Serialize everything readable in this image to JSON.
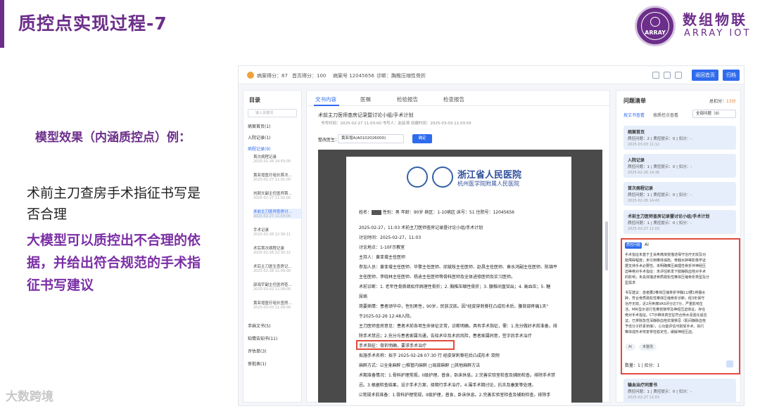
{
  "slide": {
    "title": "质控点实现过程-7",
    "brand_cn": "数组物联",
    "brand_en": "ARRAY IOT",
    "logo_text": "ARRAY",
    "model_label": "模型效果（内涵质控点）例：",
    "question": "术前主刀查房手术指征书写是否合理",
    "answer": "大模型可以质控出不合理的依据，并给出符合规范的手术指征书写建议",
    "watermark": "大数跨境"
  },
  "app": {
    "topbar": {
      "score": "病案得分：87",
      "home_score": "首页得分：100",
      "record_no": "病案号 12045656",
      "diagnosis": "诊断：胸椎压缩性骨折",
      "return_btn": "返回首页",
      "archive_btn": "归档"
    },
    "nav": {
      "title": "目录",
      "search_placeholder": "输入关键词",
      "items": [
        {
          "label": "病案首页(1)"
        },
        {
          "label": "入院记录(1)"
        },
        {
          "label": "病程记录(9)"
        }
      ],
      "subs": [
        {
          "label": "首次病程记录",
          "date": "2025-02-26 14:43:00"
        },
        {
          "label": "黄亚增医疗组长首次…",
          "date": "2025-02-27 11:01:00"
        },
        {
          "label": "刘颜文副主任医师首…",
          "date": "2025-02-27 11:02:00"
        },
        {
          "label": "术前主刀医师查房讨…",
          "date": "2025-02-27 11:03:00"
        },
        {
          "label": "手术记录",
          "date": "2025-02-28 22:30:11"
        },
        {
          "label": "术后首次病程记录",
          "date": "2025-02-28 22:30:22"
        },
        {
          "label": "术后主刀医生查房记…",
          "date": "2025-02-28 11:09:00"
        },
        {
          "label": "邵海宇副主任医师查…",
          "date": "2025-03-02 11:09:00"
        },
        {
          "label": "黄亚增医疗组长查房…",
          "date": "2025-03-03 11:09:00"
        }
      ],
      "bottom_items": [
        {
          "label": "手麻文书(5)"
        },
        {
          "label": "知情告知书(11)"
        },
        {
          "label": "评估单(3)"
        },
        {
          "label": "审批表(1)"
        }
      ]
    },
    "center": {
      "tabs": [
        "文书内容",
        "医嘱",
        "检验报告",
        "检查报告"
      ],
      "record_title": "术前主刀医师查房记录暨讨论小组/手术计划",
      "record_meta": "书写时间：2025-02-27 11:03:00     书写人：赵廷涛     创建时间：2025-03-03 11:03:55",
      "rectify_label": "整改医生：",
      "rectify_value": "黄亚增A(A0102026000)",
      "confirm_btn": "确定",
      "hospital_name": "浙江省人民医院",
      "hospital_sub": "杭州医学院附属人民医院",
      "paper_lines": [
        "姓名：[R]   性别：男  年龄：90岁    病区：1-10病区    床号：51  住院号：12045656",
        "2025-02-27，11:03        术前主刀医师查房记录暨讨论小组/手术计划",
        "讨论时间：2025-02-27，11:03",
        "讨论地点：1-10F示教室",
        "主持人：黄亚增主任医师",
        "参加人员：黄亚增主任医师、毕擎主任医师、邱斌枝主任医师、赵昌主任医师、章水鸿副主任医师、陈锦平",
        "主任医师、李晓林主任医师、杨迪主任医师等骨科医师及全体进修医师及实习医师。",
        "术前诊断：1. 老年性骨质疏松伴病理性骨折；2. 胸椎压缩性骨折；3. 腰椎间盘突出；4. 高血压；5. 糖",
        "尿病",
        "简要病情：患者顽华中，性别男性，90岁，民族汉族。因\"经皮穿刺脊柱凸成形术后，腰背部疼痛1天\"",
        "于2025-02-26 12:48入院。",
        "主刀医师查房意见：患者术前各项生命体征正常，诊断明确，具有手术指征，需：1.充分做好术前准备，排",
        "除手术禁忌；2.充分与患者家属沟通，告知术中及术后风险，患者家属同意，签字后手术治疗",
        "手术指征：骨折明确，要求手术治疗",
        "拟施手术名称：拟于 2025-02-28 07:30 行 经皮穿刺脊柱后凸成形术 双侧",
        "麻醉方式：☑全身麻醉  □椎管内麻醉  □局部麻醉  □其他麻醉方法",
        "术期准备情况：1.骨科护理常规，II级护理，普食，卧床休息。2.完善实验室检查及辅助检查。排除手术禁",
        "忌。3.根据检查结果，设计手术方案，择期行手术治疗。4.围手术期讨论，抗炎及康复等处理。",
        "☑常规术前准备：1.骨科护理常规，II级护理，普食，卧床休息。2.完善实验室检查及辅助检查。排除手"
      ]
    },
    "right": {
      "title": "问题清单",
      "total_label": "总扣分：",
      "total_value": "13分",
      "tab1": "按文书查看",
      "tab2": "按质控点查看",
      "filter": "全部问题（9）",
      "cards": [
        {
          "title": "病案首页",
          "stat": "质控问题：2  |  质控提示：0  |  扣分：-",
          "date": "2025-03-03 11:12"
        },
        {
          "title": "入院记录",
          "stat": "质控问题：1  |  质控提示：0  |  扣分：-",
          "date": "2025-02-26 14:36"
        },
        {
          "title": "首次病程记录",
          "stat": "质控问题：1  |  质控提示：0  |  扣分：-",
          "date": "2025-02-26 14:43"
        },
        {
          "title": "术前主刀医师查房记录暨讨论小组/手术计划",
          "stat": "质控问题：1  |  质控提示：0  |  扣分：-",
          "date": "2025-02-27 11:03"
        },
        {
          "title": "输血治疗同意书",
          "stat": "质控问题：1  |  质控提示：0  |  扣分：-",
          "date": "2025-02-27 11:03"
        }
      ],
      "ai": {
        "tag": "质控问题",
        "label": "AI",
        "para1": [
          "手术指征未基于主诉疼痛演变描述保守治疗无效及功",
          "能障碍程度；未引用椎体塌陷、骨髓水肿等影像学证",
          "据支持手术必要性。未明确椎压病理性骨折伴神经压",
          "迫等绝对手术指征：未评估新发下肢静脉血栓对手术",
          "的影响；未具体描述骨质疏松性椎体压缩骨折类型及分",
          "型需求"
        ],
        "para2": [
          "书写建议：患者腰2椎体压缩骨折伴胸11/腰1骨髓水",
          "肿，符合骨质疏松性椎体压缩骨折诊断，经3年保守",
          "治疗无效，近2月疼痛VAS评分达7分，严重影响生",
          "活。MRI显示进行性椎管狭窄及神经压迫体征，存在",
          "绝对手术指征。CT示椎体真空征符合骨水泥强化适应",
          "证。已排除急性深静脉血栓抗凝禁忌（肌间静脉血栓",
          "予低分子肝素桥接），心功能评估可耐受手术。拟行",
          "椎体成形术恢复脊柱稳定性，缓解神经压迫。"
        ],
        "chip1": "AI",
        "chip2": "未整改",
        "foot": "数量：1  |  扣分：1"
      }
    }
  }
}
